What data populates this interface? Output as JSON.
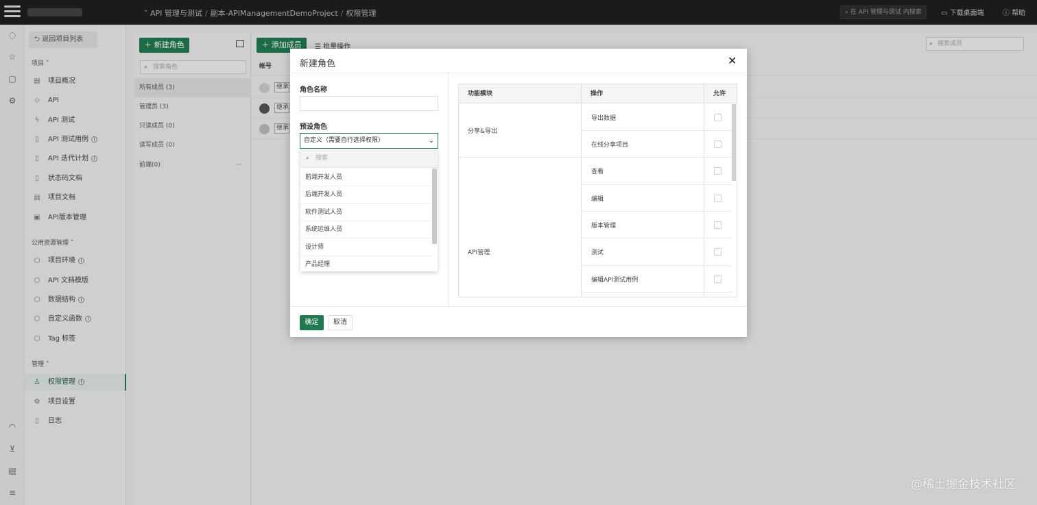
{
  "topbar": {
    "breadcrumb": [
      "API 管理与测试",
      "副本-APIManagementDemoProject",
      "权限管理"
    ],
    "search_placeholder": "在 API 管理与测试 内搜索",
    "download_label": "下载桌面端",
    "help_label": "帮助"
  },
  "sidebar": {
    "back_label": "返回项目列表",
    "sections": [
      {
        "title": "项目 ˄",
        "items": [
          "项目概况",
          "API",
          "API 测试",
          "API 测试用例",
          "API 迭代计划",
          "状态码文档",
          "项目文档",
          "API版本管理"
        ]
      },
      {
        "title": "公用资源管理 ˄",
        "items": [
          "项目环境",
          "API 文档模版",
          "数据结构",
          "自定义函数",
          "Tag 标签"
        ]
      },
      {
        "title": "管理 ˄",
        "items": [
          "权限管理",
          "项目设置",
          "日志"
        ]
      }
    ],
    "active_item": "权限管理"
  },
  "roles": {
    "new_role_button": "新建角色",
    "search_placeholder": "搜索角色",
    "items": [
      "所有成员 (3)",
      "管理员 (3)",
      "只读成员 (0)",
      "读写成员 (0)",
      "前端(0)"
    ],
    "more_icon": "···"
  },
  "members": {
    "add_member_button": "添加成员",
    "batch_button": "批量操作",
    "search_placeholder": "搜索成员",
    "column_account": "帐号",
    "rows": [
      "继承",
      "继承",
      "继承"
    ]
  },
  "modal": {
    "title": "新建角色",
    "close_icon": "✕",
    "role_name_label": "角色名称",
    "role_name_value": "",
    "preset_label": "预设角色",
    "preset_selected": "自定义（需要自行选择权限）",
    "dropdown_search_placeholder": "搜索",
    "dropdown_options": [
      "前端开发人员",
      "后端开发人员",
      "软件测试人员",
      "系统运维人员",
      "设计师",
      "产品经理"
    ],
    "table": {
      "headers": [
        "功能模块",
        "操作",
        "允许"
      ],
      "modules": [
        "分享&导出",
        "API管理"
      ],
      "operations": [
        "导出数据",
        "在线分享项目",
        "查看",
        "编辑",
        "版本管理",
        "测试",
        "编辑API测试用例"
      ],
      "allowed": [
        false,
        false,
        false,
        false,
        false,
        false,
        false
      ]
    },
    "ok_button": "确定",
    "cancel_button": "取消"
  },
  "watermark": "@稀土掘金技术社区"
}
